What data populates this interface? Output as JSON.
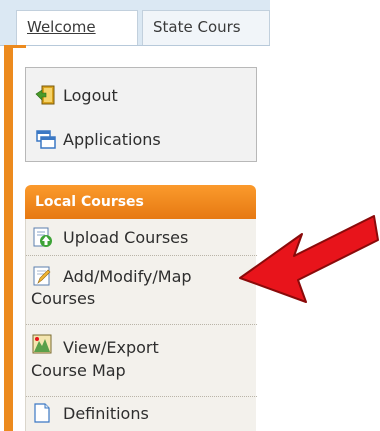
{
  "tabs": [
    {
      "label": "Welcome"
    },
    {
      "label": "State Cours"
    }
  ],
  "user_menu": {
    "logout": {
      "label": "Logout",
      "icon": "door-exit-icon"
    },
    "applications": {
      "label": "Applications",
      "icon": "windows-icon"
    }
  },
  "local_courses": {
    "header": "Local Courses",
    "items": [
      {
        "lines": [
          "Upload Courses"
        ],
        "icon": "upload-icon"
      },
      {
        "lines": [
          "Add/Modify/Map",
          "Courses"
        ],
        "icon": "edit-icon"
      },
      {
        "lines": [
          "View/Export",
          "Course Map"
        ],
        "icon": "map-icon"
      },
      {
        "lines": [
          "Definitions"
        ],
        "icon": "document-icon"
      }
    ]
  },
  "colors": {
    "accent_orange": "#ec8a1e",
    "annotation_red": "#e8141b",
    "tab_strip": "#dbe8f3",
    "panel_bg": "#f3f1ec"
  },
  "annotation": {
    "icon": "red-arrow-icon"
  }
}
